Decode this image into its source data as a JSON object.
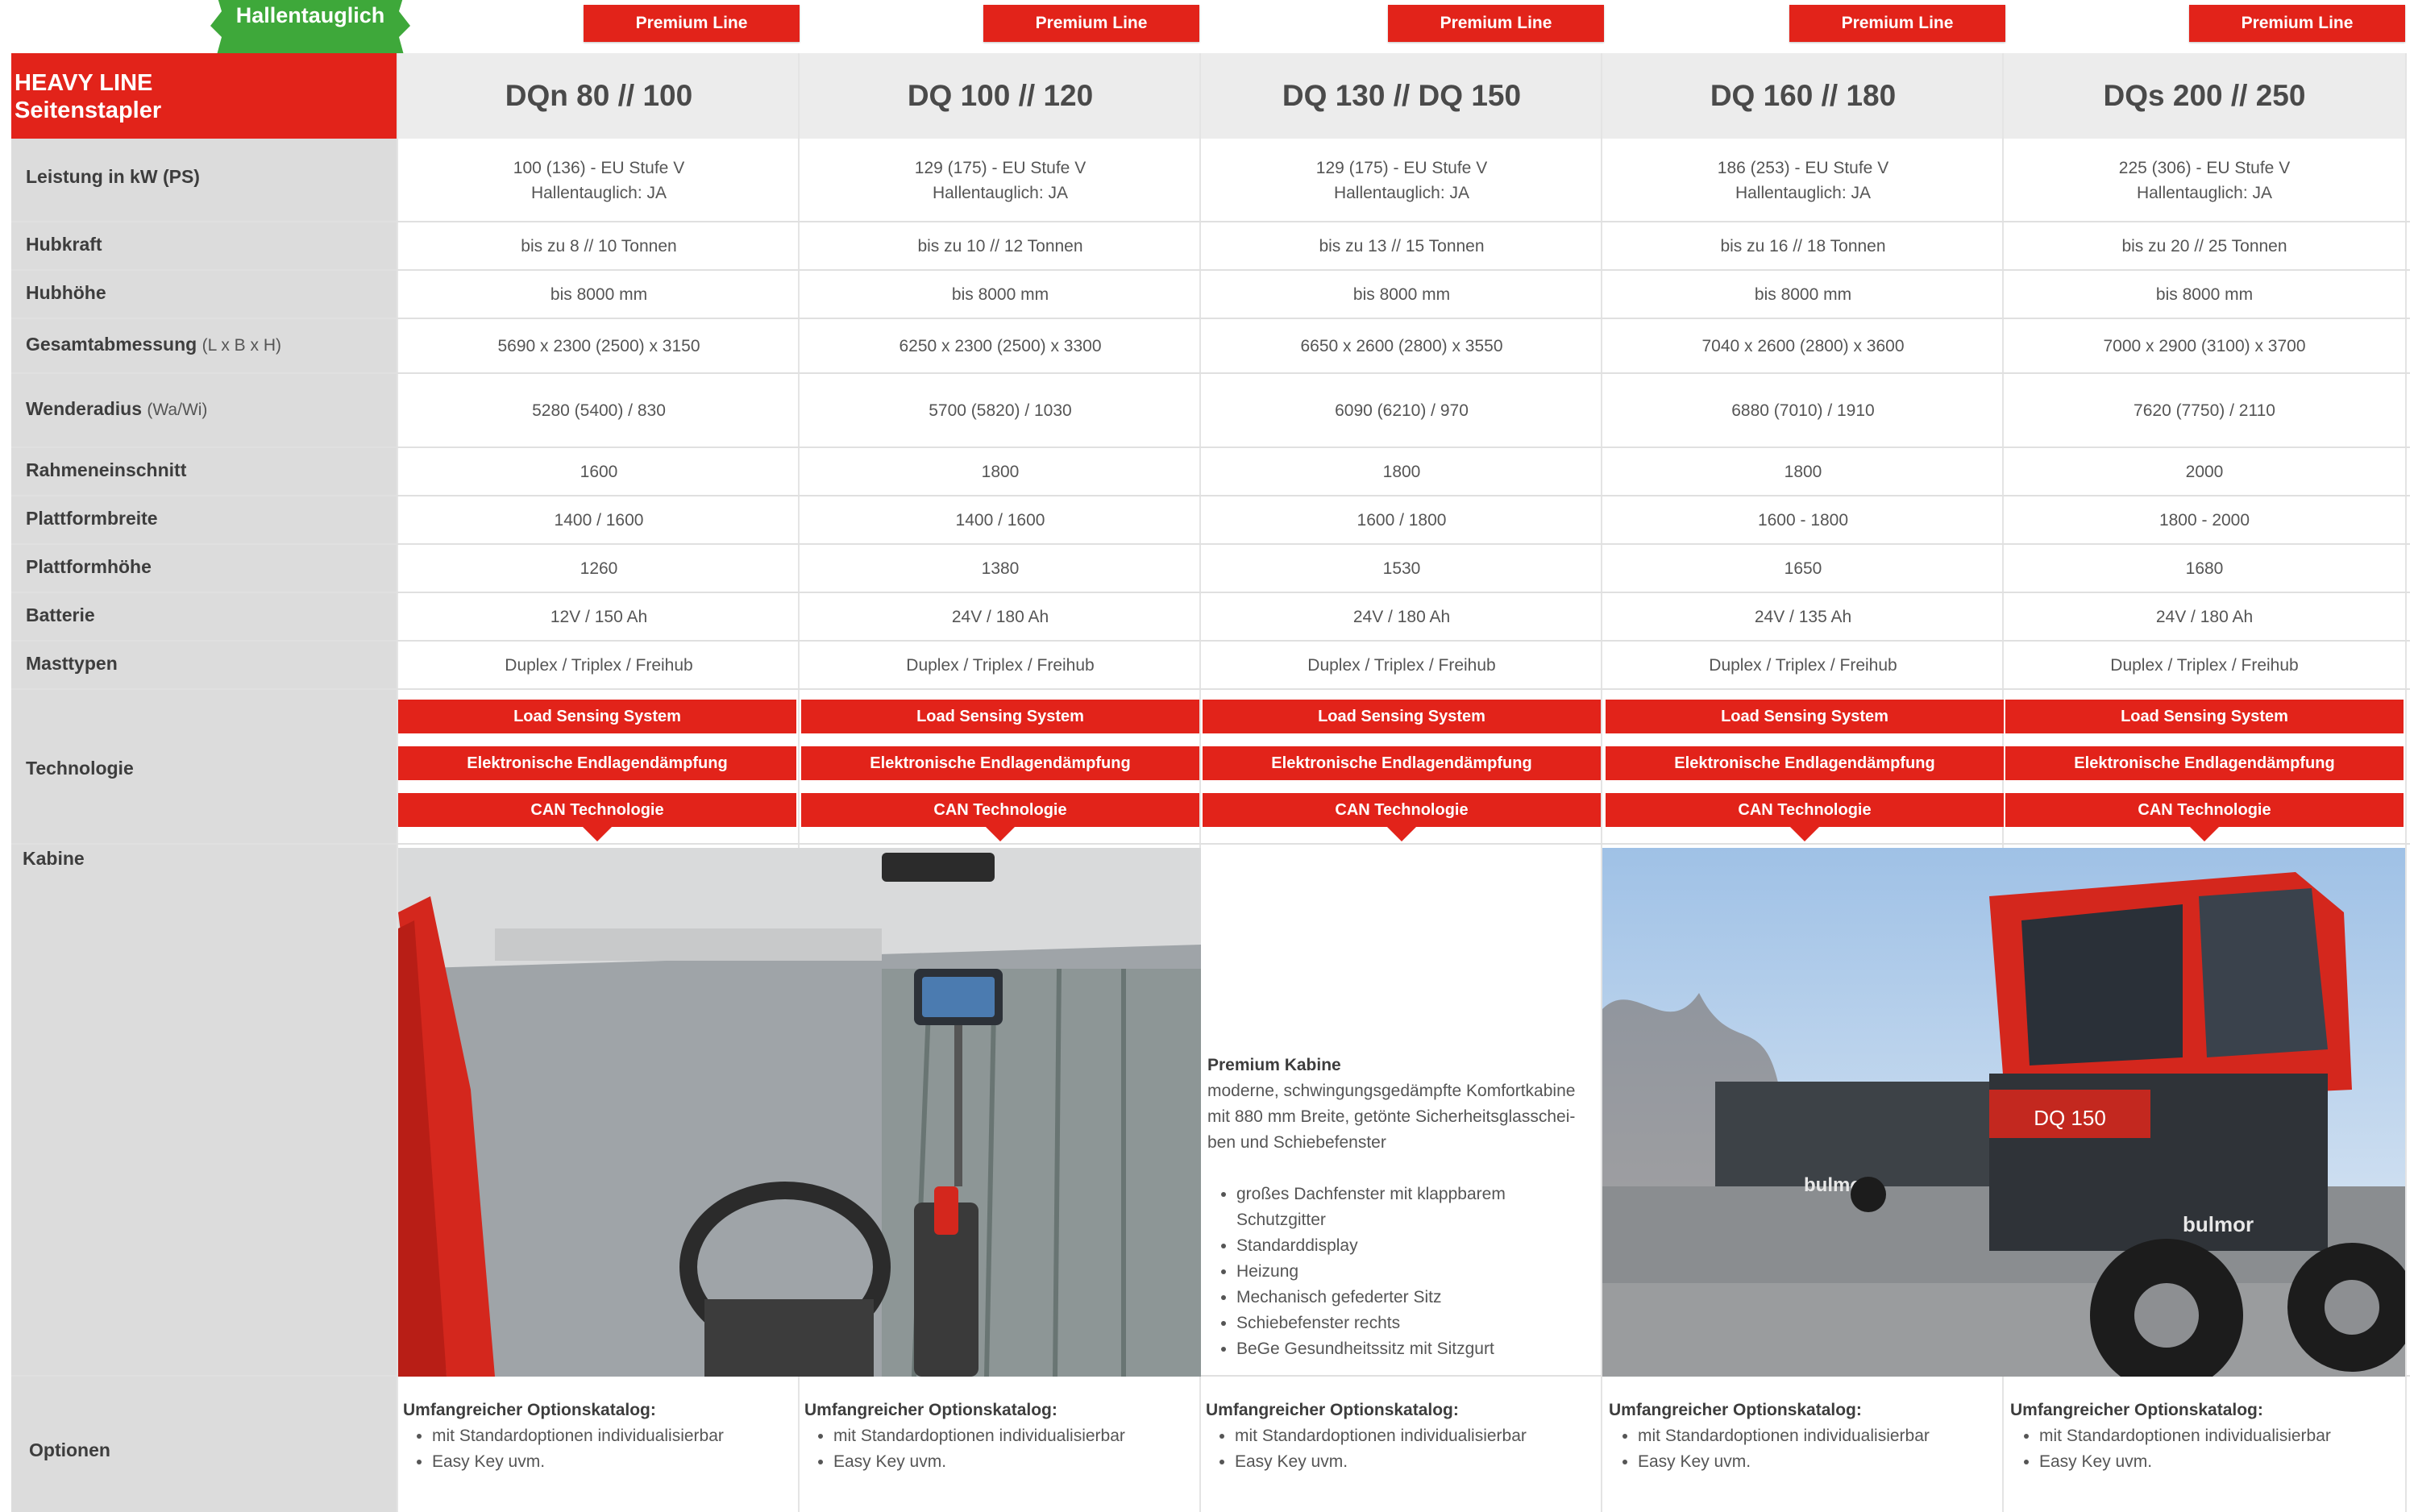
{
  "badge": {
    "text": "Hallentauglich",
    "color": "#3ea83a"
  },
  "premium_label": "Premium Line",
  "brand_red": "#e2231a",
  "header": {
    "line1": "HEAVY LINE",
    "line2": "Seitenstapler"
  },
  "models": [
    "DQn 80 // 100",
    "DQ 100 // 120",
    "DQ 130 // DQ 150",
    "DQ 160 // 180",
    "DQs 200 // 250"
  ],
  "rows": [
    {
      "label": "Leistung in kW (PS)",
      "sub": "",
      "values": [
        [
          "100 (136) - EU Stufe V",
          "Hallentauglich: JA"
        ],
        [
          "129 (175) - EU Stufe V",
          "Hallentauglich: JA"
        ],
        [
          "129 (175) - EU Stufe V",
          "Hallentauglich: JA"
        ],
        [
          "186 (253) - EU Stufe V",
          "Hallentauglich: JA"
        ],
        [
          "225 (306) - EU Stufe V",
          "Hallentauglich: JA"
        ]
      ]
    },
    {
      "label": "Hubkraft",
      "sub": "",
      "values": [
        [
          "bis zu 8 // 10 Tonnen"
        ],
        [
          "bis zu 10 // 12 Tonnen"
        ],
        [
          "bis zu 13 // 15 Tonnen"
        ],
        [
          "bis zu 16 // 18 Tonnen"
        ],
        [
          "bis zu 20 // 25 Tonnen"
        ]
      ]
    },
    {
      "label": "Hubhöhe",
      "sub": "",
      "values": [
        [
          "bis 8000 mm"
        ],
        [
          "bis 8000 mm"
        ],
        [
          "bis 8000 mm"
        ],
        [
          "bis 8000 mm"
        ],
        [
          "bis 8000 mm"
        ]
      ]
    },
    {
      "label": "Gesamtabmessung",
      "sub": "(L x B x H)",
      "values": [
        [
          "5690 x 2300 (2500) x 3150"
        ],
        [
          "6250 x 2300 (2500) x 3300"
        ],
        [
          "6650 x 2600 (2800) x 3550"
        ],
        [
          "7040 x 2600 (2800) x 3600"
        ],
        [
          "7000 x 2900 (3100) x 3700"
        ]
      ]
    },
    {
      "label": "Wenderadius",
      "sub": "(Wa/Wi)",
      "values": [
        [
          "5280 (5400) / 830"
        ],
        [
          "5700 (5820) / 1030"
        ],
        [
          "6090 (6210) / 970"
        ],
        [
          "6880 (7010) / 1910"
        ],
        [
          "7620 (7750) / 2110"
        ]
      ]
    },
    {
      "label": "Rahmeneinschnitt",
      "sub": "",
      "values": [
        [
          "1600"
        ],
        [
          "1800"
        ],
        [
          "1800"
        ],
        [
          "1800"
        ],
        [
          "2000"
        ]
      ]
    },
    {
      "label": "Plattformbreite",
      "sub": "",
      "values": [
        [
          "1400 / 1600"
        ],
        [
          "1400 / 1600"
        ],
        [
          "1600 / 1800"
        ],
        [
          "1600 - 1800"
        ],
        [
          "1800 - 2000"
        ]
      ]
    },
    {
      "label": "Plattformhöhe",
      "sub": "",
      "values": [
        [
          "1260"
        ],
        [
          "1380"
        ],
        [
          "1530"
        ],
        [
          "1650"
        ],
        [
          "1680"
        ]
      ]
    },
    {
      "label": "Batterie",
      "sub": "",
      "values": [
        [
          "12V / 150 Ah"
        ],
        [
          "24V / 180 Ah"
        ],
        [
          "24V / 180 Ah"
        ],
        [
          "24V / 135 Ah"
        ],
        [
          "24V / 180 Ah"
        ]
      ]
    },
    {
      "label": "Masttypen",
      "sub": "",
      "values": [
        [
          "Duplex / Triplex / Freihub"
        ],
        [
          "Duplex / Triplex / Freihub"
        ],
        [
          "Duplex / Triplex / Freihub"
        ],
        [
          "Duplex / Triplex / Freihub"
        ],
        [
          "Duplex / Triplex / Freihub"
        ]
      ]
    }
  ],
  "technologie": {
    "label": "Technologie",
    "items": [
      "Load Sensing System",
      "Elektronische Endlagendämpfung",
      "CAN Technologie"
    ]
  },
  "kabine": {
    "label": "Kabine",
    "title": "Premium Kabine",
    "description": "moderne, schwingungsgedämpfte Komfortkabine mit 880 mm Breite, getönte Sicherheitsglasschei- ben und Schiebefenster",
    "features": [
      "großes Dachfenster mit klappbarem Schutzgitter",
      "Standarddisplay",
      "Heizung",
      "Mechanisch gefederter Sitz",
      "Schiebefenster rechts",
      "BeGe Gesundheitssitz mit Sitzgurt"
    ],
    "truck_model": "DQ 150",
    "brand": "bulmor"
  },
  "optionen": {
    "label": "Optionen",
    "title": "Umfangreicher Optionskatalog:",
    "items": [
      "mit Standardoptionen individualisierbar",
      "Easy Key uvm."
    ]
  }
}
